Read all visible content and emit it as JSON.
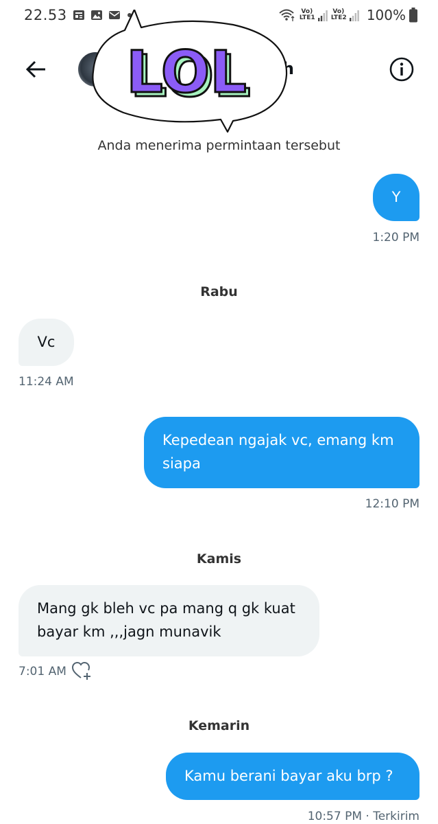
{
  "status_bar": {
    "time": "22.53",
    "notification_icons": [
      "news-icon",
      "image-icon",
      "mail-icon",
      "dot-icon"
    ],
    "network": [
      {
        "top": "Vo)",
        "bottom": "LTE1"
      },
      {
        "top": "Vo)",
        "bottom": "LTE2"
      }
    ],
    "battery": "100%"
  },
  "header": {
    "contact_name": "yah"
  },
  "sticker": {
    "text": "LOL",
    "fill_color": "#8b5cf6",
    "shadow_color": "#a7f3c0"
  },
  "chat": {
    "system_message": "Anda menerima permintaan tersebut",
    "messages": [
      {
        "direction": "out",
        "text": "Y",
        "time": "1:20 PM"
      },
      {
        "type": "day",
        "label": "Rabu"
      },
      {
        "direction": "in",
        "text": "Vc",
        "time": "11:24 AM"
      },
      {
        "direction": "out",
        "text_lines": [
          "Kepedean ngajak vc, emang km",
          "siapa"
        ],
        "time": "12:10 PM"
      },
      {
        "type": "day",
        "label": "Kamis"
      },
      {
        "direction": "in",
        "text_lines": [
          "Mang gk bleh vc pa mang q gk kuat",
          "bayar km ,,,jagn munavik"
        ],
        "time": "7:01 AM"
      },
      {
        "type": "day",
        "label": "Kemarin"
      },
      {
        "direction": "out",
        "text": "Kamu berani bayar aku brp ?",
        "time": "10:57 PM · Terkirim"
      }
    ]
  },
  "colors": {
    "outgoing_bubble": "#1d9bf0",
    "incoming_bubble": "#eff3f4",
    "timestamp": "#536471"
  }
}
